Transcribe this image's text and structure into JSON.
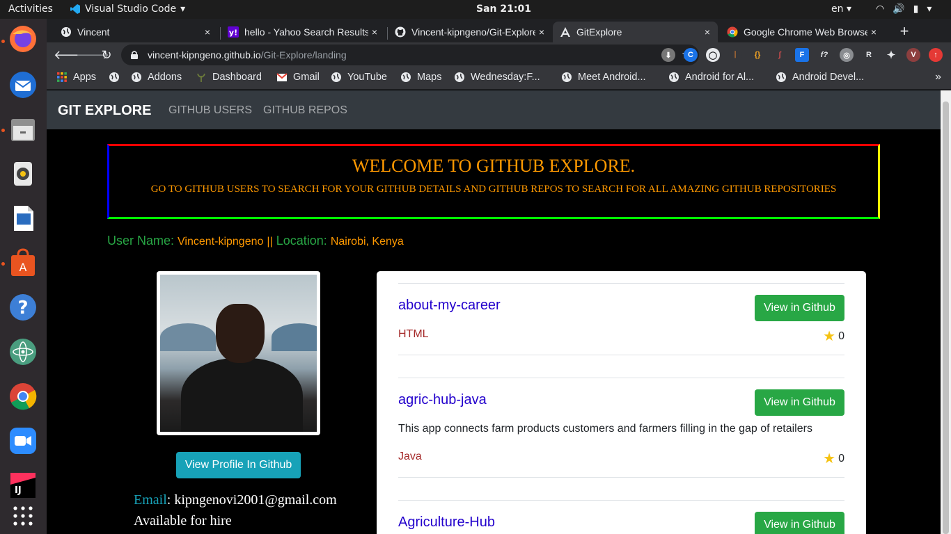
{
  "system_bar": {
    "activities": "Activities",
    "app_name": "Visual Studio Code",
    "clock": "San 21:01",
    "language": "en"
  },
  "dock": {
    "items": [
      "firefox-icon",
      "thunderbird-icon",
      "files-icon",
      "rhythmbox-icon",
      "libreoffice-writer-icon",
      "software-center-icon",
      "help-icon",
      "atom-icon",
      "chrome-icon",
      "zoom-icon",
      "intellij-icon",
      "show-apps-icon"
    ]
  },
  "tabs": [
    {
      "title": "Vincent",
      "close": "×"
    },
    {
      "title": "hello - Yahoo Search Results",
      "close": "×"
    },
    {
      "title": "Vincent-kipngeno/Git-Explore",
      "close": "×"
    },
    {
      "title": "GitExplore",
      "close": "×"
    },
    {
      "title": "Google Chrome Web Browser",
      "close": "×"
    }
  ],
  "new_tab": "+",
  "toolbar": {
    "url_host": "vincent-kipngeno.github.io",
    "url_path": "/Git-Explore/landing",
    "profile_initial": "V"
  },
  "bookmarks": [
    {
      "label": "Apps"
    },
    {
      "label": ""
    },
    {
      "label": "Addons"
    },
    {
      "label": "Dashboard"
    },
    {
      "label": "Gmail"
    },
    {
      "label": "YouTube"
    },
    {
      "label": "Maps"
    },
    {
      "label": "Wednesday:F..."
    },
    {
      "label": "Meet Android..."
    },
    {
      "label": "Android for Al..."
    },
    {
      "label": "Android Devel..."
    }
  ],
  "bookmarks_more": "»",
  "site": {
    "brand": "GIT EXPLORE",
    "nav": [
      "GITHUB USERS",
      "GITHUB REPOS"
    ],
    "welcome_title": "WELCOME TO GITHUB EXPLORE.",
    "welcome_text": "GO TO GITHUB USERS TO SEARCH FOR YOUR GITHUB DETAILS AND GITHUB REPOS TO SEARCH FOR ALL AMAZING GITHUB REPOSITORIES",
    "user_label": "User Name:",
    "user_value": "Vincent-kipngeno",
    "separator": "||",
    "location_label": "Location:",
    "location_value": "Nairobi, Kenya",
    "profile_button": "View Profile In Github",
    "email_label": "Email",
    "email_value": ": kipngenovi2001@gmail.com",
    "availability": "Available for hire",
    "repo_button": "View in Github",
    "repos": [
      {
        "name": "about-my-career",
        "description": "",
        "language": "HTML",
        "stars": "0"
      },
      {
        "name": "agric-hub-java",
        "description": "This app connects farm products customers and farmers filling in the gap of retailers",
        "language": "Java",
        "stars": "0"
      },
      {
        "name": "Agriculture-Hub",
        "description": "",
        "language": "",
        "stars": ""
      }
    ]
  },
  "colors": {
    "accent_orange": "#ff9900",
    "accent_green": "#28a745",
    "accent_teal": "#17a2b8",
    "link_blue": "#2200cc"
  }
}
